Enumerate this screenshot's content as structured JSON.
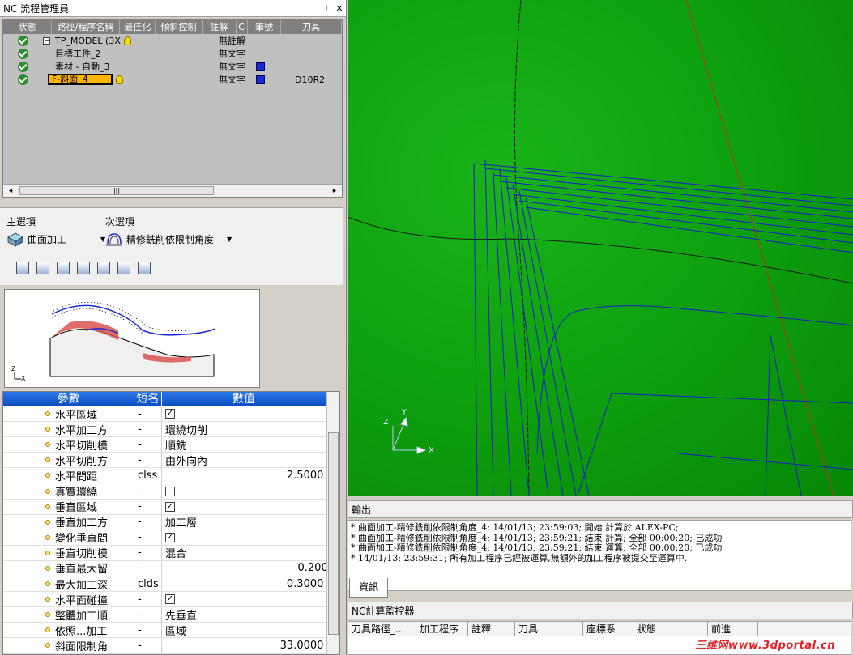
{
  "nc_manager": {
    "title": "NC 流程管理員",
    "pin_icon": "pin-icon",
    "close_icon": "close-icon",
    "columns": [
      "狀態",
      "路徑/程序名稱",
      "最佳化",
      "傾斜控制",
      "註解",
      "C",
      "筆號",
      "刀具"
    ],
    "rows": [
      {
        "name": "TP_MODEL (3X",
        "comment": "無註解",
        "tool": ""
      },
      {
        "name": "目標工件_2",
        "comment": "無文字",
        "tool": ""
      },
      {
        "name": "素材 - 自動_3",
        "comment": "無文字",
        "tool": ""
      },
      {
        "name": "F-斜面_4",
        "comment": "無文字",
        "tool": "D10R2"
      }
    ]
  },
  "selectors": {
    "main_label": "主選項",
    "sub_label": "次選項",
    "main_value": "曲面加工",
    "sub_value": "精修銑削依限制角度"
  },
  "params": {
    "headers": {
      "param": "參數",
      "short": "短名",
      "value": "數值"
    },
    "rows": [
      {
        "name": "水平區域",
        "short": "-",
        "value": "",
        "checkbox": "checked"
      },
      {
        "name": "水平加工方",
        "short": "-",
        "value": "環繞切削"
      },
      {
        "name": "水平切削模",
        "short": "-",
        "value": "順銑"
      },
      {
        "name": "水平切削方",
        "short": "-",
        "value": "由外向內"
      },
      {
        "name": "水平間距",
        "short": "clss",
        "value": "2.5000",
        "fx": "ƒ"
      },
      {
        "name": "真實環繞",
        "short": "-",
        "value": "",
        "checkbox": "unchecked"
      },
      {
        "name": "垂直區域",
        "short": "-",
        "value": "",
        "checkbox": "checked"
      },
      {
        "name": "垂直加工方",
        "short": "-",
        "value": "加工層"
      },
      {
        "name": "變化垂直間",
        "short": "-",
        "value": "",
        "checkbox": "checked"
      },
      {
        "name": "垂直切削模",
        "short": "-",
        "value": "混合"
      },
      {
        "name": "垂直最大留",
        "short": "-",
        "value": "0.2000"
      },
      {
        "name": "最大加工深",
        "short": "clds",
        "value": "0.3000",
        "fx": "ƒ"
      },
      {
        "name": "水平面碰撞",
        "short": "-",
        "value": "",
        "checkbox": "checked"
      },
      {
        "name": "整體加工順",
        "short": "-",
        "value": "先垂直"
      },
      {
        "name": "依照...加工",
        "short": "-",
        "value": "區域"
      },
      {
        "name": "斜面限制角",
        "short": "-",
        "value": "33.0000",
        "fx": "ƒ"
      }
    ]
  },
  "viewport": {
    "axes": {
      "x": "X",
      "y": "Y",
      "z": "Z"
    },
    "background": "#0ea00e",
    "toolpath_color": "#1a1acc"
  },
  "output": {
    "title": "輸出",
    "lines": [
      "* 曲面加工-精修銑削依限制角度_4; 14/01/13; 23:59:03; 開始 計算於 ALEX-PC;",
      "* 曲面加工-精修銑削依限制角度_4; 14/01/13; 23:59:21; 結束 計算; 全部 00:00:20; 已成功",
      "* 曲面加工-精修銑削依限制角度_4; 14/01/13; 23:59:21; 結束 運算; 全部 00:00:20; 已成功",
      "* 14/01/13; 23:59:31; 所有加工程序已經被運算,無額外的加工程序被提交至運算中."
    ],
    "tab": "資訊"
  },
  "monitor": {
    "title": "NC計算監控器",
    "columns": [
      "刀具路徑_...",
      "加工程序",
      "註釋",
      "刀具",
      "座標系",
      "狀態",
      "前進"
    ]
  },
  "watermark": "三维网www.3dportal.cn"
}
